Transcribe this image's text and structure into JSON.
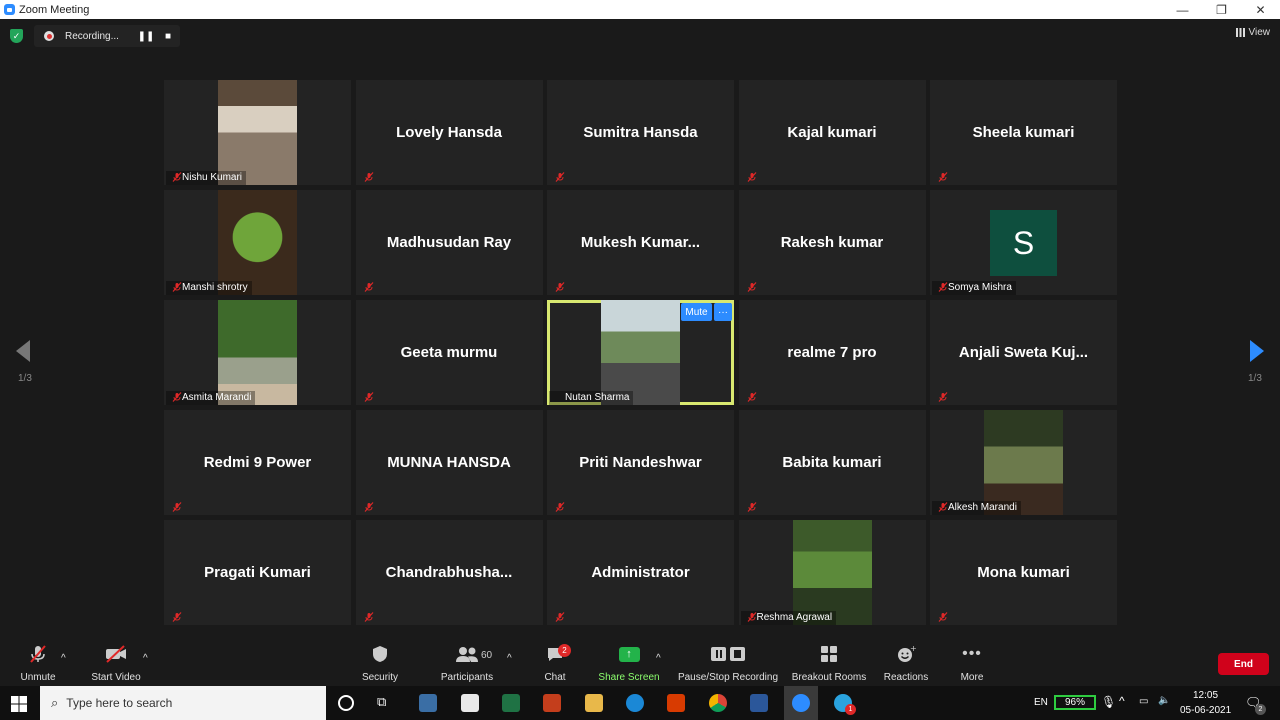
{
  "window": {
    "title": "Zoom Meeting",
    "controls": [
      "—",
      "❐",
      "✕"
    ]
  },
  "recording": {
    "status": "Recording...",
    "pause_label": "❚❚",
    "stop_label": "■"
  },
  "view_button": {
    "label": "View"
  },
  "pagination": {
    "prev": "1/3",
    "next": "1/3"
  },
  "participants": [
    {
      "name": "Nishu Kumari",
      "video": true,
      "muted": true
    },
    {
      "name": "Lovely Hansda",
      "video": false,
      "muted": true
    },
    {
      "name": "Sumitra Hansda",
      "video": false,
      "muted": true
    },
    {
      "name": "Kajal kumari",
      "video": false,
      "muted": true
    },
    {
      "name": "Sheela kumari",
      "video": false,
      "muted": true
    },
    {
      "name": "Manshi shrotry",
      "video": true,
      "muted": true
    },
    {
      "name": "Madhusudan Ray",
      "video": false,
      "muted": true
    },
    {
      "name": "Mukesh  Kumar...",
      "video": false,
      "muted": true
    },
    {
      "name": "Rakesh kumar",
      "video": false,
      "muted": true
    },
    {
      "name": "Somya Mishra",
      "video": false,
      "avatar": "S",
      "muted": true
    },
    {
      "name": "Asmita Marandi",
      "video": true,
      "muted": true
    },
    {
      "name": "Geeta murmu",
      "video": false,
      "muted": true
    },
    {
      "name": "Nutan Sharma",
      "video": true,
      "muted": false,
      "active": true
    },
    {
      "name": "realme 7 pro",
      "video": false,
      "muted": true
    },
    {
      "name": "Anjali  Sweta  Kuj...",
      "video": false,
      "muted": true
    },
    {
      "name": "Redmi 9 Power",
      "video": false,
      "muted": true
    },
    {
      "name": "MUNNA HANSDA",
      "video": false,
      "muted": true
    },
    {
      "name": "Priti Nandeshwar",
      "video": false,
      "muted": true
    },
    {
      "name": "Babita kumari",
      "video": false,
      "muted": true
    },
    {
      "name": "Alkesh Marandi",
      "video": true,
      "muted": true
    },
    {
      "name": "Pragati Kumari",
      "video": false,
      "muted": true
    },
    {
      "name": "Chandrabhusha...",
      "video": false,
      "muted": true
    },
    {
      "name": "Administrator",
      "video": false,
      "muted": true
    },
    {
      "name": "Reshma Agrawal",
      "video": true,
      "muted": true
    },
    {
      "name": "Mona kumari",
      "video": false,
      "muted": true
    }
  ],
  "tile_actions": {
    "mute": "Mute",
    "more": "···"
  },
  "toolbar": {
    "unmute": "Unmute",
    "start_video": "Start Video",
    "security": "Security",
    "participants": "Participants",
    "participants_count": "60",
    "chat": "Chat",
    "chat_badge": "2",
    "share_screen": "Share Screen",
    "recording": "Pause/Stop Recording",
    "breakout": "Breakout Rooms",
    "reactions": "Reactions",
    "more": "More",
    "end": "End"
  },
  "taskbar": {
    "search_placeholder": "Type here to search",
    "language": "EN",
    "battery": "96%",
    "time": "12:05",
    "date": "05-06-2021",
    "notification_count": "2",
    "telegram_badge": "1"
  },
  "colors": {
    "accent": "#2d8cff",
    "active_border": "#d8e870",
    "share": "#23b34a",
    "end": "#d0021b",
    "mic_off": "#e02828"
  }
}
